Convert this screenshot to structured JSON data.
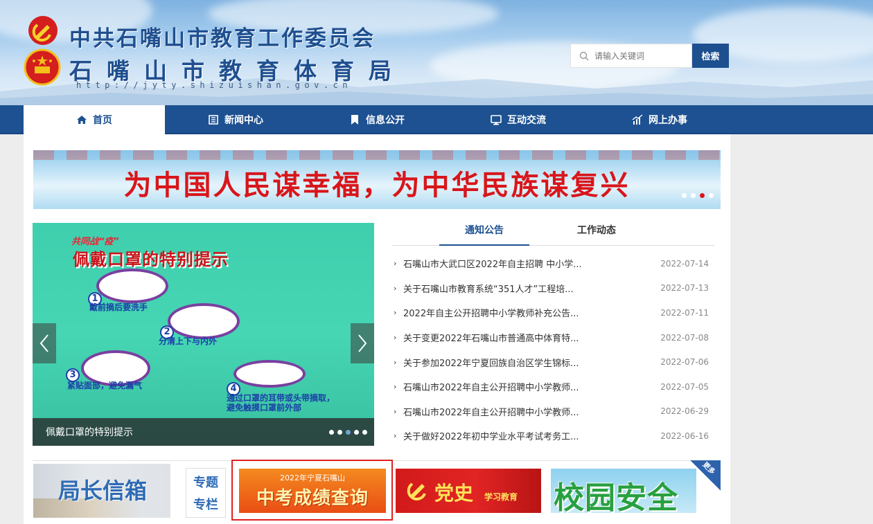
{
  "header": {
    "title_org": "中共石嘴山市教育工作委员会",
    "title_bureau": "石嘴山市教育体育局",
    "site_url": "http://jyty.shizuishan.gov.cn"
  },
  "search": {
    "placeholder": "请输入关键词",
    "button_label": "检索"
  },
  "nav": {
    "items": [
      {
        "label": "首页",
        "icon": "home-icon",
        "active": true
      },
      {
        "label": "新闻中心",
        "icon": "news-icon"
      },
      {
        "label": "信息公开",
        "icon": "bookmark-icon"
      },
      {
        "label": "互动交流",
        "icon": "monitor-icon"
      },
      {
        "label": "网上办事",
        "icon": "chart-icon"
      }
    ]
  },
  "banner": {
    "text": "为中国人民谋幸福，为中华民族谋复兴",
    "dots": 4,
    "active_dot": 3
  },
  "slider": {
    "head_small": "共同战“疫”",
    "head_big": "佩戴口罩的特别提示",
    "steps": [
      {
        "num": "1",
        "label": "戴前摘后要洗手"
      },
      {
        "num": "2",
        "label": "分清上下与内外"
      },
      {
        "num": "3",
        "label": "紧贴面部，避免漏气"
      },
      {
        "num": "4",
        "label": "通过口罩的耳带或头带摘取，避免触摸口罩前外部"
      }
    ],
    "caption": "佩戴口罩的特别提示",
    "dots": 5,
    "active_dot": 3
  },
  "news": {
    "tabs": [
      {
        "label": "通知公告",
        "active": true
      },
      {
        "label": "工作动态"
      }
    ],
    "items": [
      {
        "title": "石嘴山市大武口区2022年自主招聘 中小学...",
        "date": "2022-07-14"
      },
      {
        "title": "关于石嘴山市教育系统“351人才”工程培...",
        "date": "2022-07-13"
      },
      {
        "title": "2022年自主公开招聘中小学教师补充公告...",
        "date": "2022-07-11"
      },
      {
        "title": "关于变更2022年石嘴山市普通高中体育特...",
        "date": "2022-07-08"
      },
      {
        "title": "关于参加2022年宁夏回族自治区学生锦标...",
        "date": "2022-07-06"
      },
      {
        "title": "石嘴山市2022年自主公开招聘中小学教师...",
        "date": "2022-07-05"
      },
      {
        "title": "石嘴山市2022年自主公开招聘中小学教师...",
        "date": "2022-06-29"
      },
      {
        "title": "关于做好2022年初中学业水平考试考务工...",
        "date": "2022-06-16"
      }
    ]
  },
  "bottom": {
    "mailbox_label": "局长信箱",
    "topic_line1": "专题",
    "topic_line2": "专栏",
    "exam_small": "2022年宁夏石嘴山",
    "exam_big": "中考成绩查询",
    "history_big": "党史",
    "history_small": "学习教育",
    "campus_label": "校园安全",
    "more_label": "更多"
  },
  "colors": {
    "nav_bg": "#1d5191",
    "accent_red": "#d8161b",
    "highlight_frame": "#e02020"
  }
}
